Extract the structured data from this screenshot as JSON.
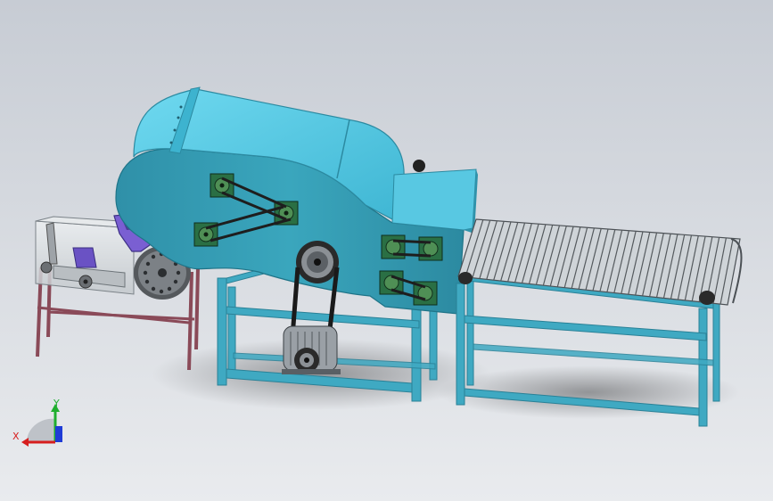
{
  "viewport": {
    "background_top": "#c7ccd4",
    "background_bottom": "#e9ebee"
  },
  "colors": {
    "body_main": "#3aa6bd",
    "body_dark": "#237e93",
    "body_light": "#62d3ea",
    "hood_top": "#52c8e4",
    "frame": "#3fa9c2",
    "frame_dark": "#2a8197",
    "tray": "#d4d8dc",
    "tray_legs": "#8a4a58",
    "hopper": "#7a5fd2",
    "hopper_dark": "#4b3f94",
    "belt": "#1e1e1e",
    "sprocket": "#3f7f3a",
    "motor": "#9aa0a6",
    "conveyor_slats": "#bcc2c6",
    "conveyor_slats_dark": "#555a5e"
  },
  "triad": {
    "x_label": "X",
    "y_label": "Y",
    "x_color": "#d61e1e",
    "y_color": "#1fae2e",
    "z_color": "#1e3bd6"
  }
}
